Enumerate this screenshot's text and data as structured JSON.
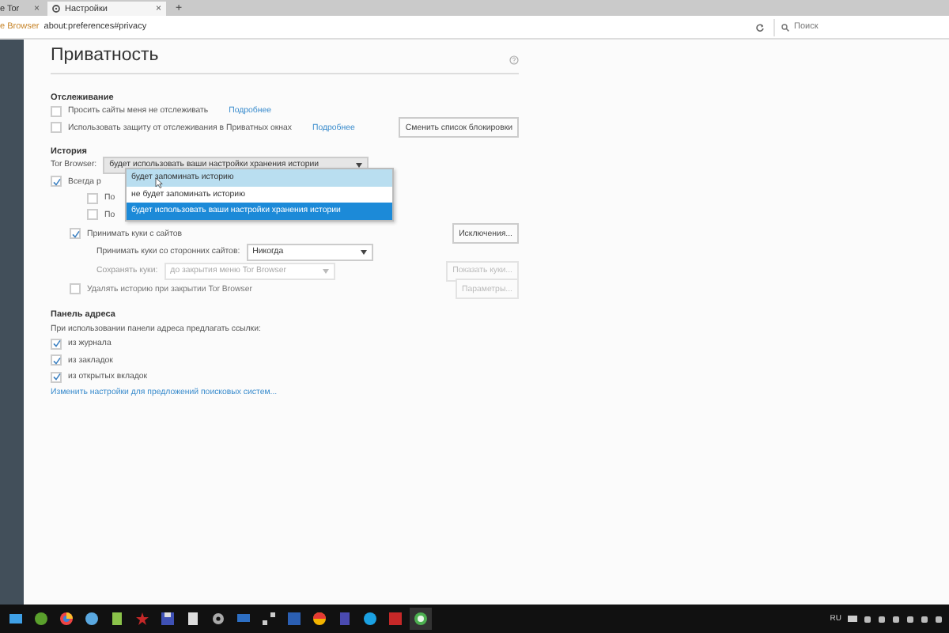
{
  "tabs": [
    {
      "label": "e Tor",
      "selected": false,
      "close": "×"
    },
    {
      "label": "Настройки",
      "selected": true,
      "close": "×"
    }
  ],
  "new_tab": "+",
  "address_bar": {
    "identity": "e Browser",
    "url": "about:preferences#privacy",
    "search_placeholder": "Поиск"
  },
  "page": {
    "title": "Приватность",
    "tracking": {
      "heading": "Отслеживание",
      "rows": [
        {
          "label": "Просить сайты меня не отслеживать",
          "checked": false,
          "link": "Подробнее"
        },
        {
          "label": "Использовать защиту от отслеживания в Приватных окнах",
          "checked": false,
          "link": "Подробнее",
          "button": "Сменить список блокировки"
        }
      ]
    },
    "history": {
      "heading": "История",
      "select_label": "Tor Browser:",
      "select_value": "будет использовать ваши настройки хранения истории",
      "dropdown": [
        {
          "label": "будет запоминать историю",
          "hovered": true,
          "selected": false
        },
        {
          "label": "не будет запоминать историю",
          "hovered": false,
          "selected": false
        },
        {
          "label": "будет использовать ваши настройки хранения истории",
          "hovered": false,
          "selected": true
        }
      ],
      "rows": [
        {
          "kind": "top_check",
          "label": "Всегда р",
          "checked": true
        },
        {
          "kind": "sub_check",
          "label": "По",
          "checked": false
        },
        {
          "kind": "sub_check",
          "label": "По",
          "checked": false
        },
        {
          "kind": "check",
          "label": "Принимать куки с сайтов",
          "checked": true,
          "button": "Исключения..."
        },
        {
          "kind": "select",
          "label": "Принимать куки со сторонних сайтов:",
          "value": "Никогда"
        },
        {
          "kind": "select",
          "label": "Сохранять куки:",
          "value": "до закрытия меню Tor Browser",
          "disabled": true,
          "button": "Показать куки..."
        },
        {
          "kind": "check",
          "label": "Удалять историю при закрытии Tor Browser",
          "checked": false,
          "button": "Параметры...",
          "disabled": true
        }
      ]
    },
    "address": {
      "heading": "Панель адреса",
      "intro": "При использовании панели адреса предлагать ссылки:",
      "rows": [
        {
          "label": "из журнала",
          "checked": true
        },
        {
          "label": "из закладок",
          "checked": true
        },
        {
          "label": "из открытых вкладок",
          "checked": true
        }
      ],
      "link": "Изменить настройки для предложений поисковых систем..."
    }
  },
  "taskbar": {
    "language": "RU"
  }
}
